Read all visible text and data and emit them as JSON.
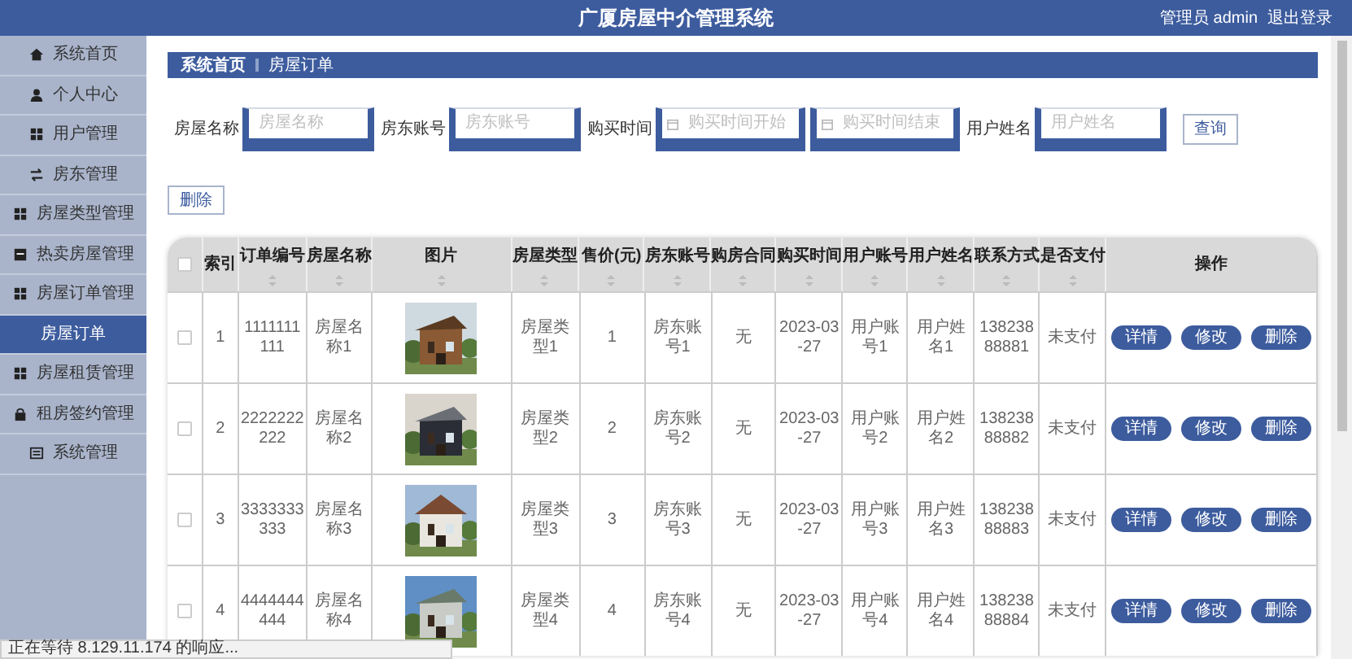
{
  "header": {
    "title": "广厦房屋中介管理系统",
    "user": "管理员 admin",
    "logout": "退出登录"
  },
  "sidebar": {
    "items": [
      {
        "label": "系统首页",
        "selected": false
      },
      {
        "label": "个人中心",
        "selected": false
      },
      {
        "label": "用户管理",
        "selected": false
      },
      {
        "label": "房东管理",
        "selected": false
      },
      {
        "label": "房屋类型管理",
        "selected": false
      },
      {
        "label": "热卖房屋管理",
        "selected": false
      },
      {
        "label": "房屋订单管理",
        "selected": false,
        "children": [
          {
            "label": "房屋订单",
            "selected": true
          }
        ]
      },
      {
        "label": "房屋租赁管理",
        "selected": false
      },
      {
        "label": "租房签约管理",
        "selected": false
      },
      {
        "label": "系统管理",
        "selected": false
      }
    ]
  },
  "breadcrumb": [
    "系统首页",
    "房屋订单"
  ],
  "search": {
    "fields": [
      {
        "label": "房屋名称",
        "placeholder": "房屋名称",
        "kind": "text"
      },
      {
        "label": "房东账号",
        "placeholder": "房东账号",
        "kind": "text"
      },
      {
        "label": "购买时间",
        "placeholder": "购买时间开始",
        "kind": "date"
      },
      {
        "placeholder": "购买时间结束",
        "kind": "date"
      },
      {
        "label": "用户姓名",
        "placeholder": "用户姓名",
        "kind": "text"
      }
    ],
    "button": "查询"
  },
  "delete_button": "删除",
  "table": {
    "header_checked": false,
    "columns": [
      {
        "label": "索引",
        "sortable": false
      },
      {
        "label": "订单编号",
        "sortable": true
      },
      {
        "label": "房屋名称",
        "sortable": true
      },
      {
        "label": "图片",
        "sortable": true
      },
      {
        "label": "房屋类型",
        "sortable": true
      },
      {
        "label": "售价(元)",
        "sortable": true
      },
      {
        "label": "房东账号",
        "sortable": true
      },
      {
        "label": "购房合同",
        "sortable": true
      },
      {
        "label": "购买时间",
        "sortable": true
      },
      {
        "label": "用户账号",
        "sortable": true
      },
      {
        "label": "用户姓名",
        "sortable": true
      },
      {
        "label": "联系方式",
        "sortable": true
      },
      {
        "label": "是否支付",
        "sortable": true
      },
      {
        "label": "操作",
        "sortable": false
      }
    ],
    "rows": [
      {
        "checked": false,
        "cells": [
          "1",
          "1111111111",
          "房屋名称1",
          null,
          "房屋类型1",
          "1",
          "房东账号1",
          "无",
          "2023-03-27",
          "用户账号1",
          "用户姓名1",
          "13823888881",
          "未支付"
        ],
        "actions": [
          "详情",
          "修改",
          "删除"
        ]
      },
      {
        "checked": false,
        "cells": [
          "2",
          "2222222222",
          "房屋名称2",
          null,
          "房屋类型2",
          "2",
          "房东账号2",
          "无",
          "2023-03-27",
          "用户账号2",
          "用户姓名2",
          "13823888882",
          "未支付"
        ],
        "actions": [
          "详情",
          "修改",
          "删除"
        ]
      },
      {
        "checked": false,
        "cells": [
          "3",
          "3333333333",
          "房屋名称3",
          null,
          "房屋类型3",
          "3",
          "房东账号3",
          "无",
          "2023-03-27",
          "用户账号3",
          "用户姓名3",
          "13823888883",
          "未支付"
        ],
        "actions": [
          "详情",
          "修改",
          "删除"
        ]
      },
      {
        "checked": false,
        "cells": [
          "4",
          "4444444444",
          "房屋名称4",
          null,
          "房屋类型4",
          "4",
          "房东账号4",
          "无",
          "2023-03-27",
          "用户账号4",
          "用户姓名4",
          "13823888884",
          "未支付"
        ],
        "actions": [
          "详情",
          "修改",
          "删除"
        ]
      }
    ]
  },
  "status_bar": "正在等待 8.129.11.174 的响应..."
}
